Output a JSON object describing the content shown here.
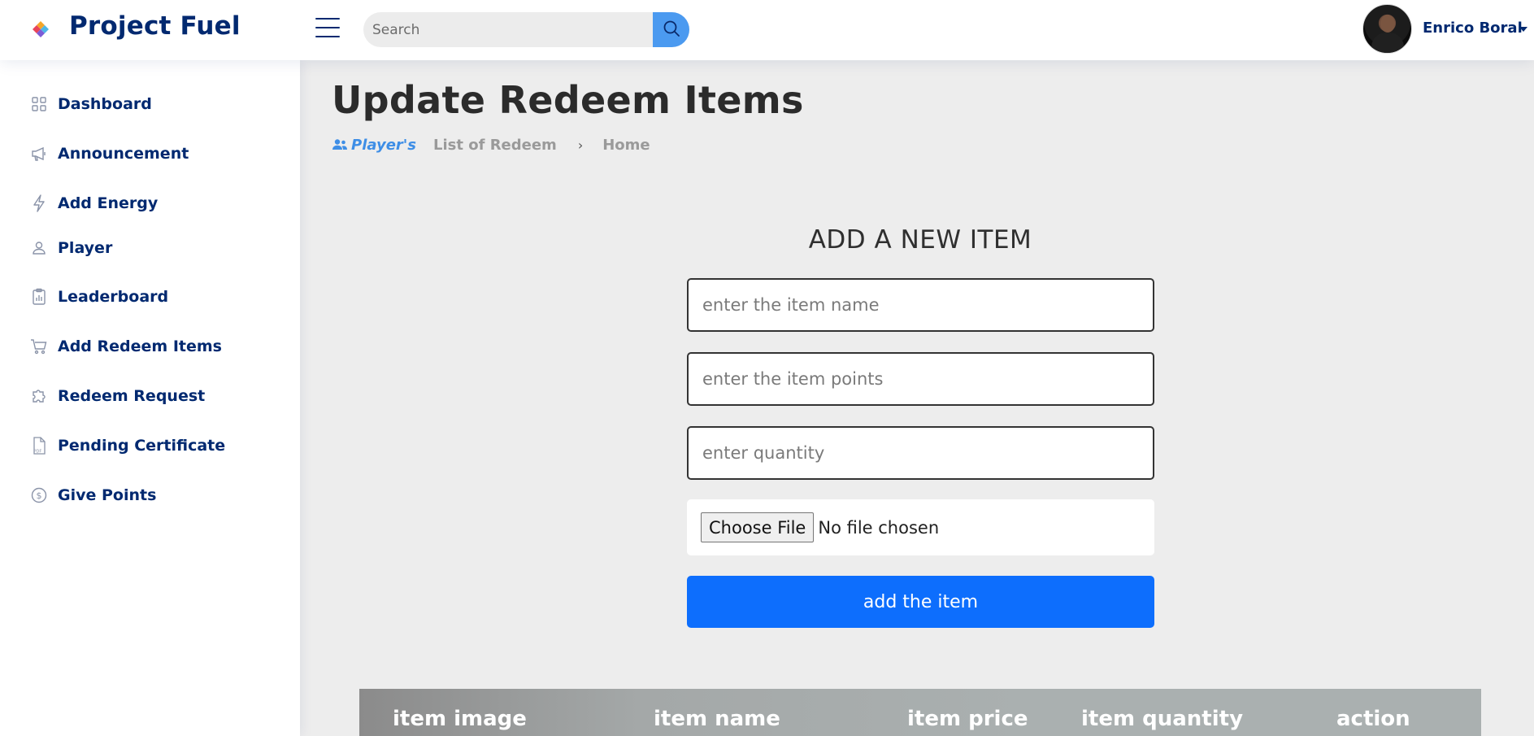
{
  "app": {
    "title": "Project Fuel"
  },
  "header": {
    "search_placeholder": "Search",
    "search_icon": "search-icon",
    "menu_icon": "hamburger-menu-icon",
    "user_name": "Enrico Boral"
  },
  "sidebar": {
    "items": [
      {
        "label": "Dashboard",
        "icon": "grid-icon"
      },
      {
        "label": "Announcement",
        "icon": "megaphone-icon"
      },
      {
        "label": "Add Energy",
        "icon": "lightning-icon"
      },
      {
        "label": "Player",
        "icon": "person-icon"
      },
      {
        "label": "Leaderboard",
        "icon": "clipboard-chart-icon"
      },
      {
        "label": "Add Redeem Items",
        "icon": "cart-icon"
      },
      {
        "label": "Redeem Request",
        "icon": "puzzle-icon"
      },
      {
        "label": "Pending Certificate",
        "icon": "pdf-file-icon"
      },
      {
        "label": "Give Points",
        "icon": "coin-icon"
      }
    ]
  },
  "page": {
    "title": "Update Redeem Items",
    "breadcrumb": {
      "players": "Player's",
      "list": "List of Redeem",
      "separator": "›",
      "home": "Home"
    }
  },
  "form": {
    "title": "ADD A NEW ITEM",
    "item_name_placeholder": "enter the item name",
    "item_points_placeholder": "enter the item points",
    "quantity_placeholder": "enter quantity",
    "file_button_label": "Choose File",
    "file_status": "No file chosen",
    "submit_label": "add the item"
  },
  "table": {
    "columns": [
      "item image",
      "item name",
      "item price",
      "item quantity",
      "action"
    ]
  },
  "colors": {
    "brand": "#012970",
    "primary_button": "#0d6efd",
    "search_button": "#4b9af0",
    "breadcrumb_active": "#3e8ee6"
  }
}
